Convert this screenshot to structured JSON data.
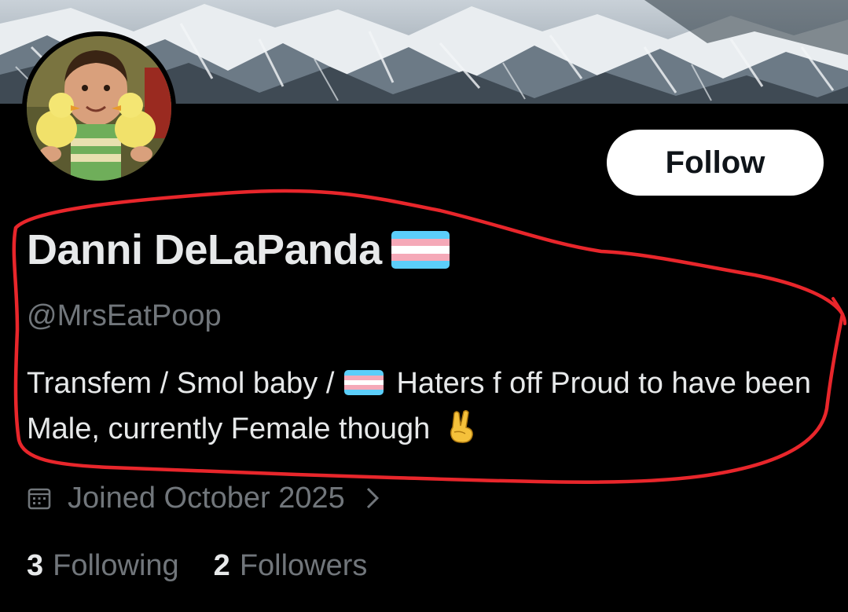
{
  "profile": {
    "display_name": "Danni DeLaPanda",
    "handle": "@MrsEatPoop",
    "bio_part1": "Transfem / Smol baby /",
    "bio_part2": "Haters f off Proud to have been Male, currently Female though",
    "joined": "Joined October 2025",
    "following_count": "3",
    "following_label": "Following",
    "followers_count": "2",
    "followers_label": "Followers"
  },
  "actions": {
    "follow_label": "Follow"
  },
  "icons": {
    "name_flag": "transgender-flag-icon",
    "bio_flag": "transgender-flag-icon",
    "bio_emoji": "victory-hand-icon",
    "joined": "calendar-icon",
    "joined_more": "chevron-right-icon"
  },
  "colors": {
    "background": "#000000",
    "primary_text": "#e7e9ea",
    "secondary_text": "#71767b",
    "follow_button_bg": "#ffffff",
    "follow_button_text": "#0f1419",
    "annotation_stroke": "#e8262b",
    "flag_blue": "#5bcefa",
    "flag_pink": "#f5a9b8",
    "flag_white": "#ffffff"
  }
}
